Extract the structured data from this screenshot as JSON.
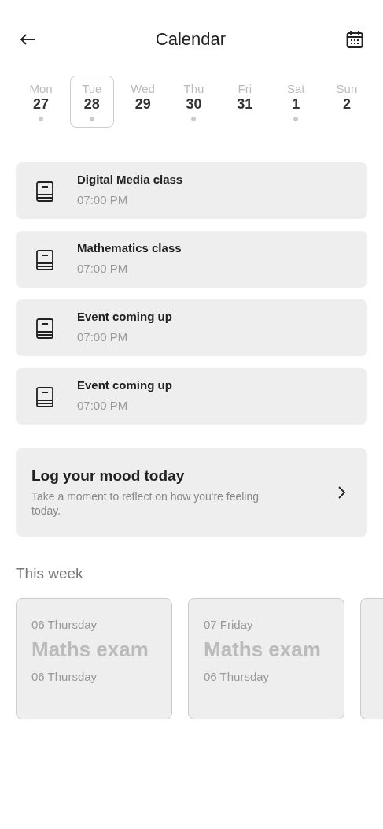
{
  "header": {
    "title": "Calendar"
  },
  "days": [
    {
      "weekday": "Mon",
      "date": "27",
      "selected": false,
      "has_event": true
    },
    {
      "weekday": "Tue",
      "date": "28",
      "selected": true,
      "has_event": true
    },
    {
      "weekday": "Wed",
      "date": "29",
      "selected": false,
      "has_event": false
    },
    {
      "weekday": "Thu",
      "date": "30",
      "selected": false,
      "has_event": true
    },
    {
      "weekday": "Fri",
      "date": "31",
      "selected": false,
      "has_event": false
    },
    {
      "weekday": "Sat",
      "date": "1",
      "selected": false,
      "has_event": true
    },
    {
      "weekday": "Sun",
      "date": "2",
      "selected": false,
      "has_event": false
    }
  ],
  "events": [
    {
      "title": "Digital Media class",
      "time": "07:00 PM"
    },
    {
      "title": "Mathematics class",
      "time": "07:00 PM"
    },
    {
      "title": "Event coming up",
      "time": "07:00 PM"
    },
    {
      "title": "Event coming up",
      "time": "07:00 PM"
    }
  ],
  "mood_card": {
    "title": "Log your mood today",
    "description": "Take a moment to reflect on how you're feeling today."
  },
  "this_week": {
    "heading": "This week",
    "cards": [
      {
        "date": "06 Thursday",
        "title": "Maths exam",
        "subtitle": "06 Thursday"
      },
      {
        "date": "07 Friday",
        "title": "Maths exam",
        "subtitle": "06 Thursday"
      }
    ]
  }
}
